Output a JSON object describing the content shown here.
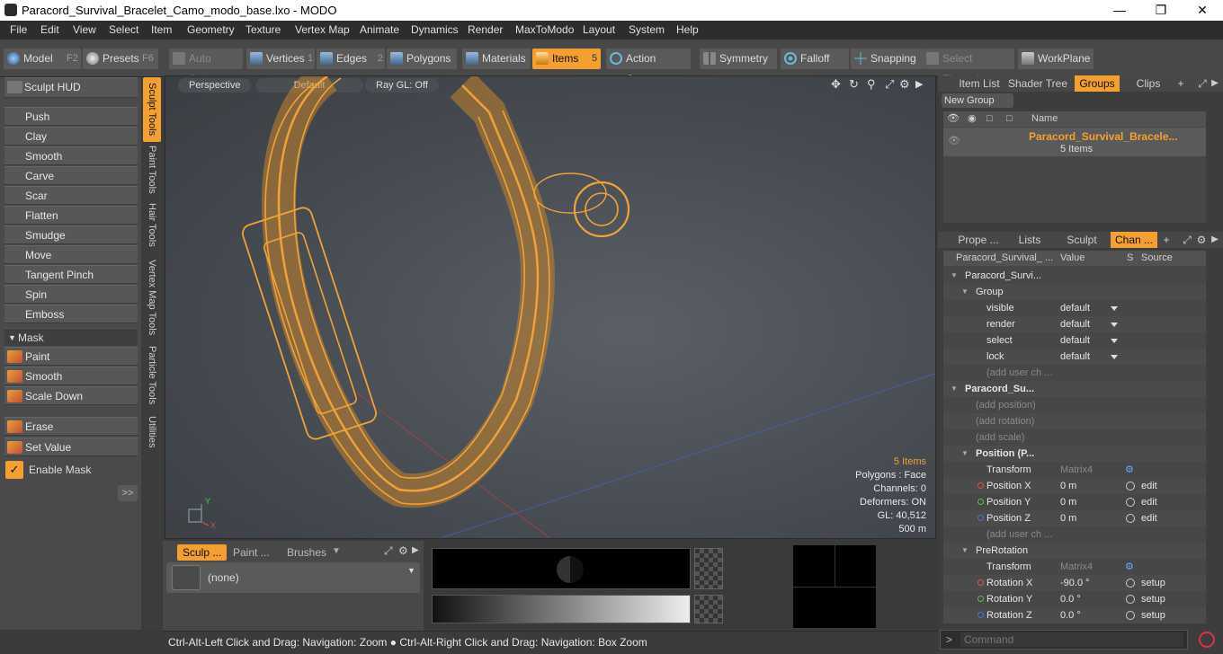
{
  "window": {
    "title": "Paracord_Survival_Bracelet_Camo_modo_base.lxo - MODO"
  },
  "menu": [
    "File",
    "Edit",
    "View",
    "Select",
    "Item",
    "Geometry",
    "Texture",
    "Vertex Map",
    "Animate",
    "Dynamics",
    "Render",
    "MaxToModo",
    "Layout",
    "System",
    "Help"
  ],
  "toolbar": {
    "model": "Model",
    "model_key": "F2",
    "presets": "Presets",
    "presets_key": "F6",
    "auto_select": "Auto Select",
    "vertices": "Vertices",
    "vertices_num": "1",
    "edges": "Edges",
    "edges_num": "2",
    "polygons": "Polygons",
    "materials": "Materials",
    "items": "Items",
    "items_num": "5",
    "action_center": "Action Center",
    "symmetry": "Symmetry",
    "falloff": "Falloff",
    "snapping": "Snapping",
    "select_through": "Select Through",
    "workplane": "WorkPlane"
  },
  "sculpt": {
    "hud": "Sculpt HUD",
    "tools": [
      "Push",
      "Clay",
      "Smooth",
      "Carve",
      "Scar",
      "Flatten",
      "Smudge",
      "Move",
      "Tangent Pinch",
      "Spin",
      "Emboss"
    ],
    "mask_header": "Mask",
    "mask_tools": [
      "Paint",
      "Smooth",
      "Scale Down"
    ],
    "erase": "Erase",
    "set_value": "Set Value",
    "enable_mask": "Enable Mask",
    "expand": ">>"
  },
  "vtabs": [
    "Sculpt Tools",
    "Paint Tools",
    "Hair Tools",
    "Vertex Map Tools",
    "Particle Tools",
    "Utilities"
  ],
  "viewport": {
    "view": "Perspective",
    "shading": "Default",
    "raygl": "Ray GL: Off",
    "stats": [
      "5 Items",
      "Polygons : Face",
      "Channels: 0",
      "Deformers: ON",
      "GL: 40,512",
      "500 m"
    ]
  },
  "bottom": {
    "tabs": [
      "Sculp ...",
      "Paint ...",
      "Brushes"
    ],
    "brush": "(none)"
  },
  "status": "Ctrl-Alt-Left Click and Drag: Navigation: Zoom ● Ctrl-Alt-Right Click and Drag: Navigation: Box Zoom",
  "command_placeholder": "Command",
  "items_panel": {
    "tabs": [
      "Item List",
      "Shader Tree",
      "Groups",
      "Clips"
    ],
    "new_group": "New Group",
    "col_name": "Name",
    "group_name": "Paracord_Survival_Bracele...",
    "group_count": "5 Items"
  },
  "channels_panel": {
    "tabs": [
      "Prope ...",
      "Lists",
      "Sculpt",
      "Chan ..."
    ],
    "headers": [
      "Paracord_Survival_ ...",
      "Value",
      "S",
      "Source"
    ],
    "rows": [
      {
        "indent": 0,
        "label": "Paracord_Survi...",
        "value": "",
        "source": "",
        "kind": "head"
      },
      {
        "indent": 1,
        "label": "Group",
        "value": "",
        "source": "",
        "kind": "head"
      },
      {
        "indent": 2,
        "label": "visible",
        "value": "default",
        "source": "",
        "kind": "dd"
      },
      {
        "indent": 2,
        "label": "render",
        "value": "default",
        "source": "",
        "kind": "dd"
      },
      {
        "indent": 2,
        "label": "select",
        "value": "default",
        "source": "",
        "kind": "dd"
      },
      {
        "indent": 2,
        "label": "lock",
        "value": "default",
        "source": "",
        "kind": "dd"
      },
      {
        "indent": 2,
        "label": "(add user ch ...",
        "value": "",
        "source": "",
        "kind": "dim"
      },
      {
        "indent": 0,
        "label": "Paracord_Su...",
        "value": "",
        "source": "",
        "kind": "bold"
      },
      {
        "indent": 1,
        "label": "(add position)",
        "value": "",
        "source": "",
        "kind": "dim"
      },
      {
        "indent": 1,
        "label": "(add rotation)",
        "value": "",
        "source": "",
        "kind": "dim"
      },
      {
        "indent": 1,
        "label": "(add scale)",
        "value": "",
        "source": "",
        "kind": "dim"
      },
      {
        "indent": 1,
        "label": "Position (P...",
        "value": "",
        "source": "",
        "kind": "bold"
      },
      {
        "indent": 2,
        "label": "Transform",
        "value": "Matrix4",
        "source": "",
        "kind": "matrix"
      },
      {
        "indent": 2,
        "label": "Position X",
        "value": "0 m",
        "source": "edit",
        "kind": "x"
      },
      {
        "indent": 2,
        "label": "Position Y",
        "value": "0 m",
        "source": "edit",
        "kind": "y"
      },
      {
        "indent": 2,
        "label": "Position Z",
        "value": "0 m",
        "source": "edit",
        "kind": "z"
      },
      {
        "indent": 2,
        "label": "(add user ch ...",
        "value": "",
        "source": "",
        "kind": "dim"
      },
      {
        "indent": 1,
        "label": "PreRotation",
        "value": "",
        "source": "",
        "kind": "head"
      },
      {
        "indent": 2,
        "label": "Transform",
        "value": "Matrix4",
        "source": "",
        "kind": "matrix"
      },
      {
        "indent": 2,
        "label": "Rotation X",
        "value": "-90.0 °",
        "source": "setup",
        "kind": "x"
      },
      {
        "indent": 2,
        "label": "Rotation Y",
        "value": "0.0 °",
        "source": "setup",
        "kind": "y"
      },
      {
        "indent": 2,
        "label": "Rotation Z",
        "value": "0.0 °",
        "source": "setup",
        "kind": "z"
      }
    ]
  },
  "colors": {
    "accent": "#f4a030",
    "wire": "#f0a23a"
  }
}
